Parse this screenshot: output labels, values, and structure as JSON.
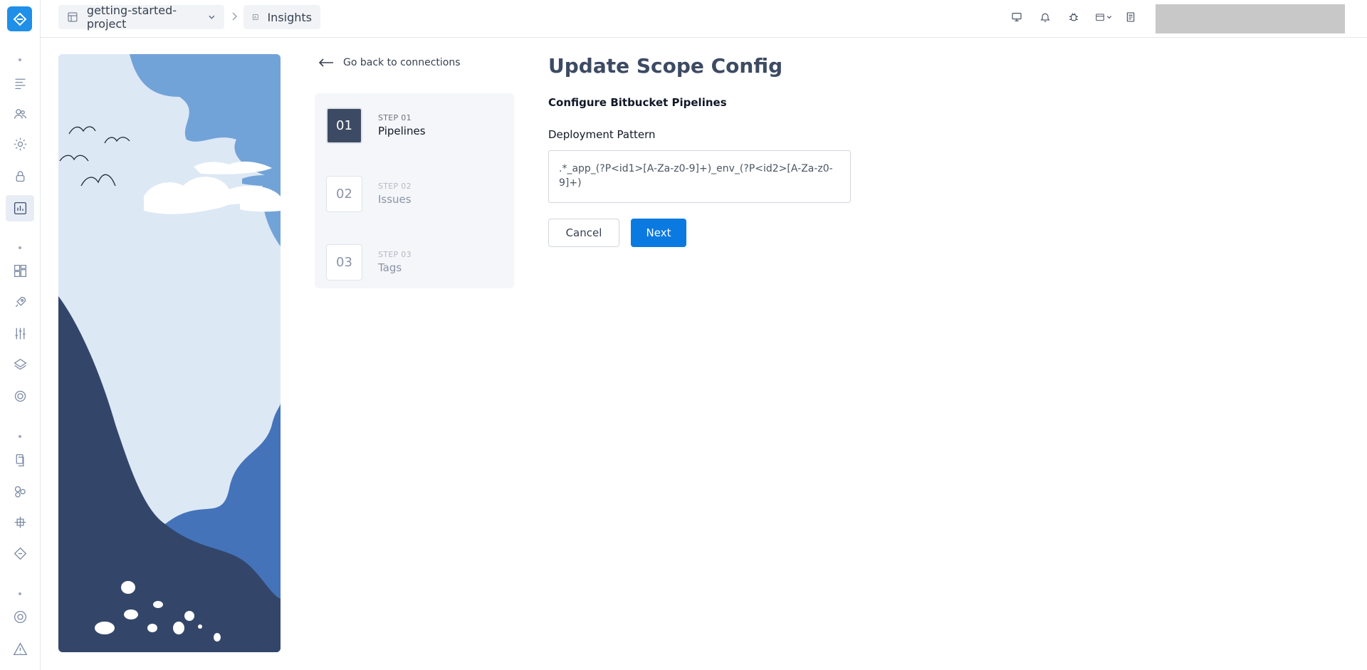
{
  "topbar": {
    "project": "getting-started-project",
    "section": "Insights"
  },
  "sidebar": {
    "items": [
      "menu-icon",
      "users-icon",
      "gear-icon",
      "lock-icon",
      "chart-icon",
      "blocks-icon",
      "rocket-icon",
      "sliders-icon",
      "layers-icon",
      "badge-icon",
      "docs-icon",
      "circles-icon",
      "integration-icon",
      "diamond-icon",
      "target-icon",
      "warning-icon"
    ],
    "active": "chart-icon"
  },
  "steps": {
    "back_label": "Go back to connections",
    "items": [
      {
        "num": "01",
        "label": "STEP 01",
        "name": "Pipelines"
      },
      {
        "num": "02",
        "label": "STEP 02",
        "name": "Issues"
      },
      {
        "num": "03",
        "label": "STEP 03",
        "name": "Tags"
      }
    ],
    "active_index": 0
  },
  "form": {
    "title": "Update Scope Config",
    "subtitle": "Configure Bitbucket Pipelines",
    "deployment_label": "Deployment Pattern",
    "deployment_value": ".*_app_(?P<id1>[A-Za-z0-9]+)_env_(?P<id2>[A-Za-z0-9]+)",
    "cancel_label": "Cancel",
    "next_label": "Next"
  },
  "colors": {
    "accent": "#0b7ae0",
    "brand": "#1f8fe8",
    "title": "#3d4a63",
    "illustration_dark": "#33466a",
    "illustration_mid": "#4473b9",
    "illustration_light": "#dde8f5"
  }
}
